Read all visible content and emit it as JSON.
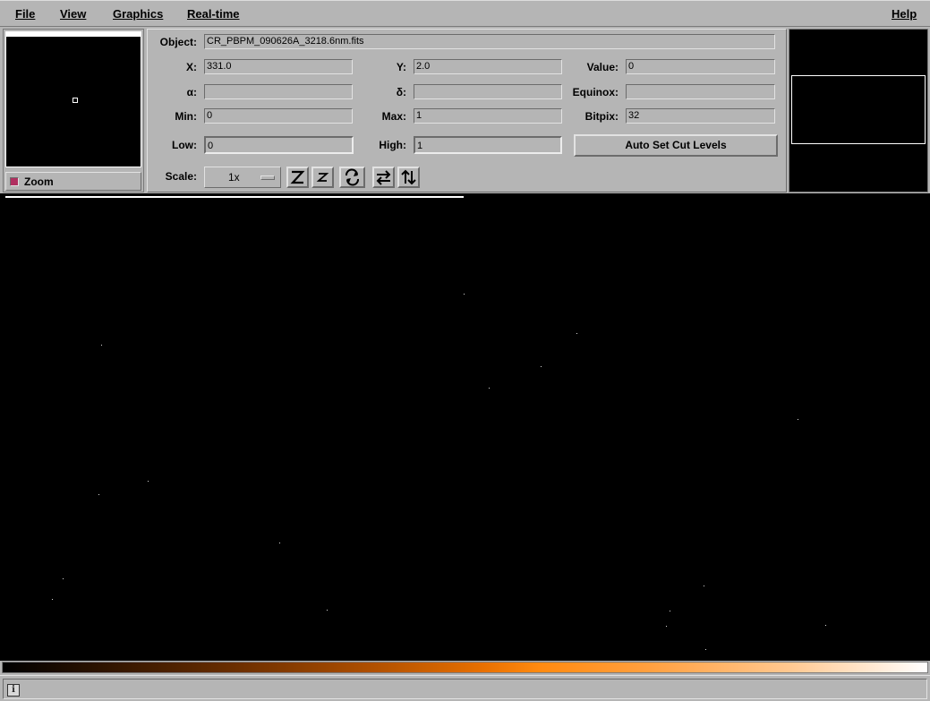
{
  "menu": {
    "file": "File",
    "view": "View",
    "graphics": "Graphics",
    "realtime": "Real-time",
    "help": "Help"
  },
  "zoom": {
    "label": "Zoom"
  },
  "info": {
    "object_label": "Object:",
    "object_value": "CR_PBPM_090626A_3218.6nm.fits",
    "x_label": "X:",
    "x_value": "331.0",
    "y_label": "Y:",
    "y_value": "2.0",
    "value_label": "Value:",
    "value_value": "0",
    "alpha_label": "α:",
    "alpha_value": "",
    "delta_label": "δ:",
    "delta_value": "",
    "equinox_label": "Equinox:",
    "equinox_value": "",
    "min_label": "Min:",
    "min_value": "0",
    "max_label": "Max:",
    "max_value": "1",
    "bitpix_label": "Bitpix:",
    "bitpix_value": "32",
    "low_label": "Low:",
    "low_value": "0",
    "high_label": "High:",
    "high_value": "1",
    "auto_cut_label": "Auto Set Cut Levels",
    "scale_label": "Scale:",
    "scale_value": "1x"
  },
  "toolbar_icons": [
    "zoom-in-icon",
    "zoom-out-icon",
    "rotate-icon",
    "flip-x-icon",
    "flip-y-icon"
  ],
  "colormap": {
    "name": "heat",
    "colors": [
      "#000000",
      "#6a2e00",
      "#e87000",
      "#ff8a10",
      "#ffc890",
      "#ffffff"
    ]
  },
  "status": {
    "icon": "info-icon",
    "icon_glyph": "i"
  }
}
